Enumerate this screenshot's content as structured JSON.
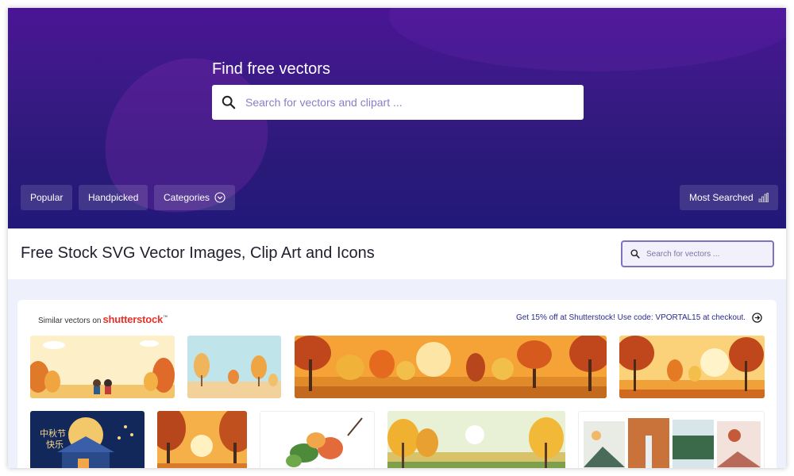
{
  "hero": {
    "title": "Find free vectors",
    "search_placeholder": "Search for vectors and clipart ..."
  },
  "filters": {
    "popular": "Popular",
    "handpicked": "Handpicked",
    "categories": "Categories",
    "most_searched": "Most Searched"
  },
  "page": {
    "title": "Free Stock SVG Vector Images, Clip Art and Icons",
    "search_placeholder": "Search for vectors ..."
  },
  "shutterstock": {
    "similar_label": "Similar vectors on",
    "brand": "shutterstock",
    "promo": "Get 15% off at Shutterstock! Use code: VPORTAL15 at checkout."
  },
  "thumbnail_text": {
    "chinese_caption_1": "中秋节",
    "chinese_caption_2": "快乐"
  },
  "colors": {
    "hero_top": "#4a1595",
    "hero_bottom": "#22187a",
    "accent": "#7e72c4",
    "brand_red": "#e8312a"
  },
  "icons": {
    "search": "search-icon",
    "categories_toggle": "chevron-down-circle-icon",
    "most_searched": "bar-chart-icon",
    "promo_arrow": "arrow-right-circle-icon"
  }
}
